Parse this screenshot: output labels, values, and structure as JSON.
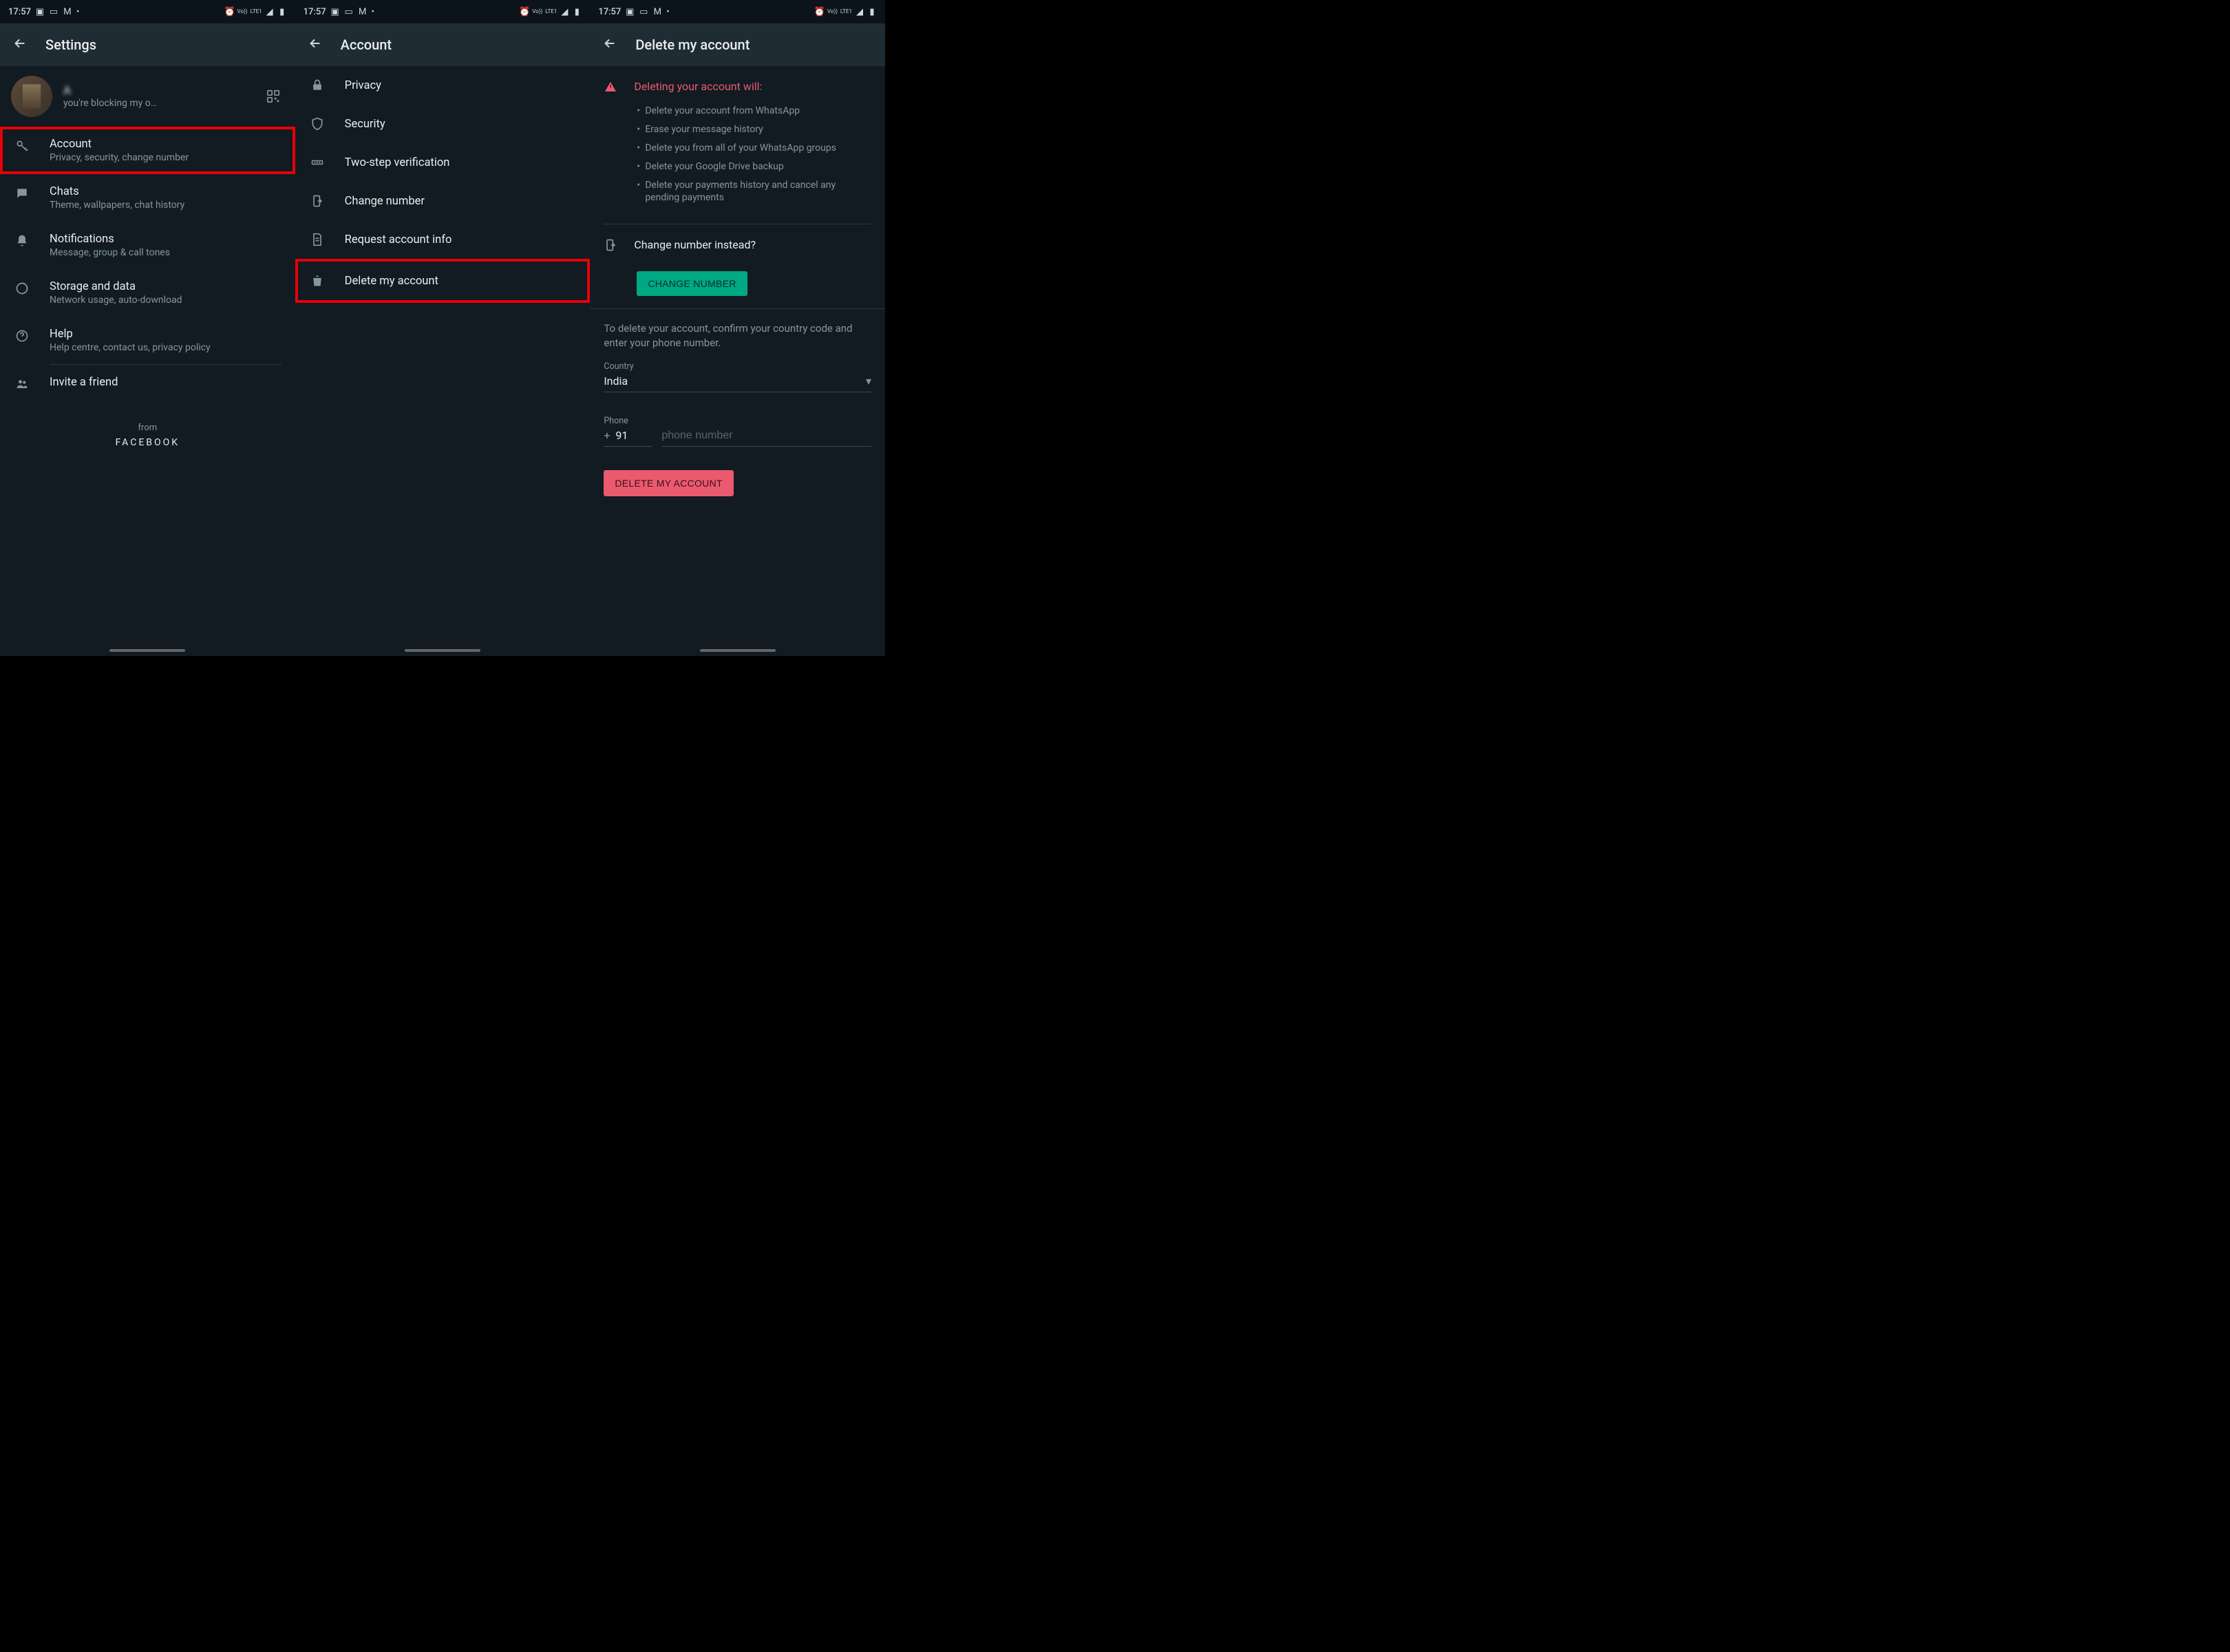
{
  "statusbar": {
    "time": "17:57",
    "net": "LTE1",
    "vo": "Vo))"
  },
  "screen1": {
    "title": "Settings",
    "profile_status_blur": "A",
    "profile_status": "you're blocking my o…",
    "rows": [
      {
        "icon": "key",
        "title": "Account",
        "sub": "Privacy, security, change number",
        "highlight": true
      },
      {
        "icon": "chat",
        "title": "Chats",
        "sub": "Theme, wallpapers, chat history"
      },
      {
        "icon": "bell",
        "title": "Notifications",
        "sub": "Message, group & call tones"
      },
      {
        "icon": "data",
        "title": "Storage and data",
        "sub": "Network usage, auto-download"
      },
      {
        "icon": "help",
        "title": "Help",
        "sub": "Help centre, contact us, privacy policy"
      }
    ],
    "invite": "Invite a friend",
    "from": "from",
    "fb": "FACEBOOK"
  },
  "screen2": {
    "title": "Account",
    "rows": [
      {
        "icon": "lock",
        "label": "Privacy"
      },
      {
        "icon": "shield",
        "label": "Security"
      },
      {
        "icon": "dots",
        "label": "Two-step verification"
      },
      {
        "icon": "change",
        "label": "Change number"
      },
      {
        "icon": "doc",
        "label": "Request account info"
      },
      {
        "icon": "trash",
        "label": "Delete my account",
        "highlight": true
      }
    ]
  },
  "screen3": {
    "title": "Delete my account",
    "warning_title": "Deleting your account will:",
    "bullets": [
      "Delete your account from WhatsApp",
      "Erase your message history",
      "Delete you from all of your WhatsApp groups",
      "Delete your Google Drive backup",
      "Delete your payments history and cancel any pending payments"
    ],
    "change_instead": "Change number instead?",
    "change_btn": "CHANGE NUMBER",
    "confirm_text": "To delete your account, confirm your country code and enter your phone number.",
    "country_label": "Country",
    "country_value": "India",
    "phone_label": "Phone",
    "cc": "91",
    "phone_placeholder": "phone number",
    "delete_btn": "DELETE MY ACCOUNT"
  }
}
